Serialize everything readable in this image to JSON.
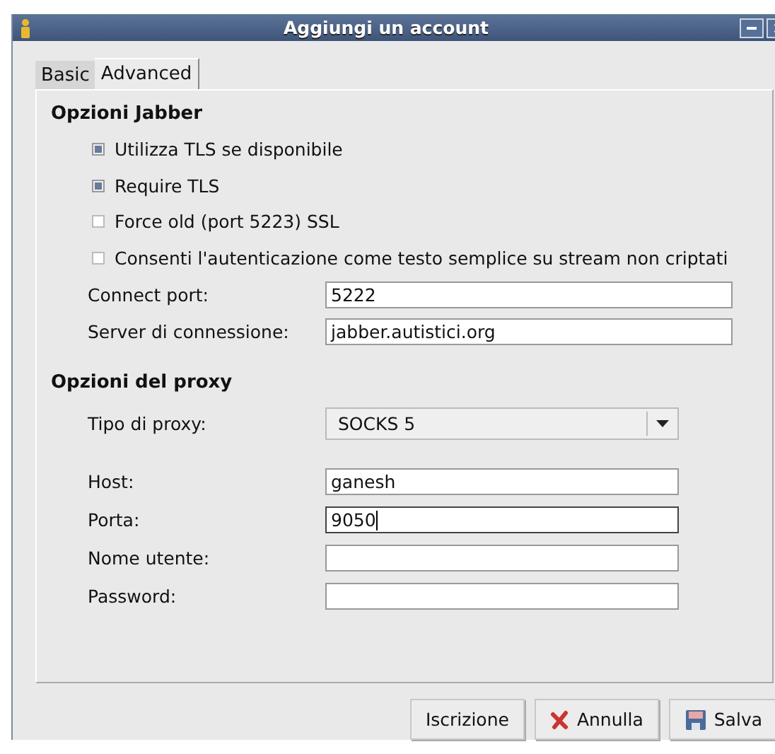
{
  "window": {
    "title": "Aggiungi un account"
  },
  "tabs": [
    {
      "label": "Basic",
      "selected": false
    },
    {
      "label": "Advanced",
      "selected": true
    }
  ],
  "jabber": {
    "heading": "Opzioni Jabber",
    "checkboxes": [
      {
        "label": "Utilizza TLS se disponibile",
        "checked": true
      },
      {
        "label": "Require TLS",
        "checked": true
      },
      {
        "label": "Force old (port 5223) SSL",
        "checked": false
      },
      {
        "label": "Consenti l'autenticazione come testo semplice su stream non criptati",
        "checked": false
      }
    ],
    "fields": [
      {
        "label": "Connect port:",
        "value": "5222"
      },
      {
        "label": "Server di connessione:",
        "value": "jabber.autistici.org"
      }
    ]
  },
  "proxy": {
    "heading": "Opzioni del proxy",
    "type": {
      "label": "Tipo di proxy:",
      "value": "SOCKS 5"
    },
    "fields": [
      {
        "label": "Host:",
        "value": "ganesh",
        "focused": false
      },
      {
        "label": "Porta:",
        "value": "9050",
        "focused": true
      },
      {
        "label": "Nome utente:",
        "focused": false
      },
      {
        "label": "Password:",
        "focused": false
      }
    ]
  },
  "buttons": [
    {
      "kind": "plain",
      "label": "Iscrizione"
    },
    {
      "kind": "cancel",
      "label": "Annulla"
    },
    {
      "kind": "save",
      "label": "Salva"
    }
  ]
}
